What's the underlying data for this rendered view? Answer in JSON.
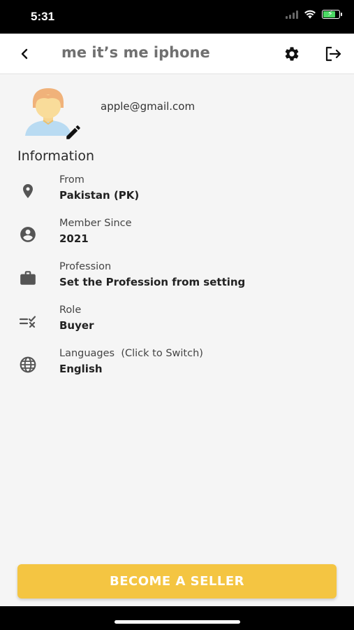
{
  "status_bar": {
    "time": "5:31"
  },
  "header": {
    "title": "me it’s me iphone"
  },
  "profile": {
    "email": "apple@gmail.com"
  },
  "info": {
    "section_title": "Information",
    "rows": [
      {
        "label": "From",
        "value": "Pakistan (PK)",
        "icon": "location-pin-icon"
      },
      {
        "label": "Member Since",
        "value": "2021",
        "icon": "account-circle-icon"
      },
      {
        "label": "Profession",
        "value": "Set the Profession from setting",
        "icon": "briefcase-icon"
      },
      {
        "label": "Role",
        "value": "Buyer",
        "icon": "role-rule-icon"
      },
      {
        "label": "Languages  (Click to Switch)",
        "value": "English",
        "icon": "globe-icon"
      }
    ]
  },
  "actions": {
    "become_seller": "BECOME A SELLER"
  },
  "colors": {
    "accent": "#f4c542",
    "title_gray": "#707070",
    "icon_gray": "#555555"
  }
}
